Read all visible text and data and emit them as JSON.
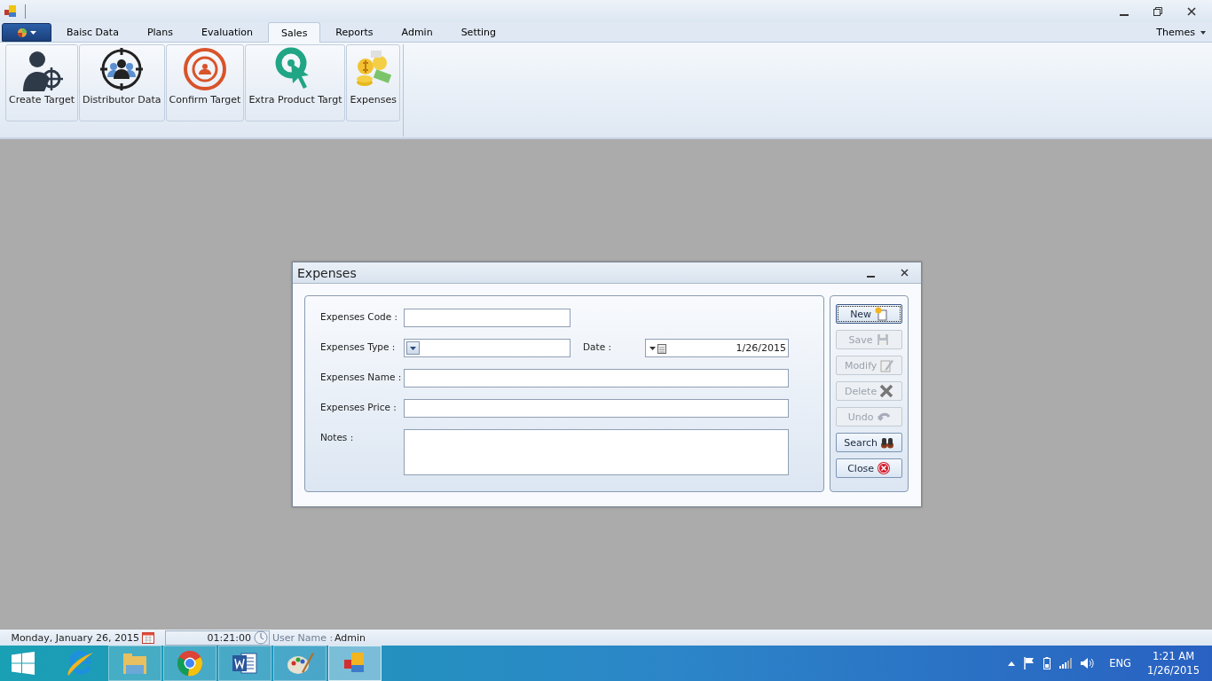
{
  "ribbon": {
    "app_menu": {
      "selected": false
    },
    "tabs": [
      {
        "label": "Baisc Data",
        "selected": false
      },
      {
        "label": "Plans",
        "selected": false
      },
      {
        "label": "Evaluation",
        "selected": false
      },
      {
        "label": "Sales",
        "selected": true
      },
      {
        "label": "Reports",
        "selected": false
      },
      {
        "label": "Admin",
        "selected": false
      },
      {
        "label": "Setting",
        "selected": false
      }
    ],
    "themes": "Themes",
    "buttons": [
      {
        "label": "Create Target"
      },
      {
        "label": "Distributor Data"
      },
      {
        "label": "Confirm Target"
      },
      {
        "label": "Extra Product Targt"
      },
      {
        "label": "Expenses"
      }
    ]
  },
  "dialog": {
    "title": "Expenses",
    "rows": [
      [
        {
          "label": "Expenses Code :",
          "kind": "short"
        }
      ],
      [
        {
          "label": "Expenses Type :",
          "kind": "combo"
        },
        {
          "label": "Date :",
          "kind": "date",
          "value": "1/26/2015"
        }
      ],
      [
        {
          "label": "Expenses Name :",
          "kind": "text"
        }
      ],
      [
        {
          "label": "Expenses Price :",
          "kind": "text"
        }
      ],
      [
        {
          "label": "Notes :",
          "kind": "memo"
        }
      ]
    ],
    "buttons": [
      {
        "label": "New",
        "disabled": false,
        "focused": true
      },
      {
        "label": "Save",
        "disabled": true,
        "focused": false
      },
      {
        "label": "Modify",
        "disabled": true,
        "focused": false
      },
      {
        "label": "Delete",
        "disabled": true,
        "focused": false
      },
      {
        "label": "Undo",
        "disabled": true,
        "focused": false
      },
      {
        "label": "Search",
        "disabled": false,
        "focused": false
      },
      {
        "label": "Close",
        "disabled": false,
        "focused": false
      }
    ]
  },
  "status_bar": {
    "date": "Monday, January 26, 2015",
    "time": "01:21:00",
    "user_label": "User Name :",
    "user": "Admin"
  },
  "taskbar": {
    "apps": [
      {
        "selected": false
      },
      {
        "selected": false
      },
      {
        "selected": false
      },
      {
        "selected": false
      },
      {
        "selected": false
      },
      {
        "selected": true
      }
    ],
    "tray": {
      "language": "ENG",
      "time": "1:21 AM",
      "date": "1/26/2015"
    }
  }
}
